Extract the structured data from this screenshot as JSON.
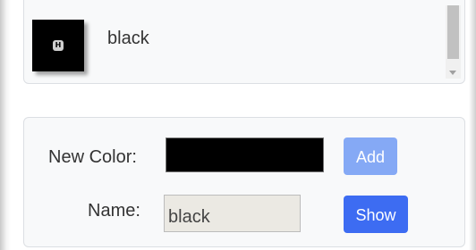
{
  "color_list": {
    "items": [
      {
        "label": "black",
        "swatch_color": "#000000",
        "icon": "app-icon"
      }
    ]
  },
  "form": {
    "new_color_label": "New Color:",
    "new_color_value": "#000000",
    "name_label": "Name:",
    "name_value": "black",
    "add_label": "Add",
    "show_label": "Show"
  },
  "colors": {
    "add_button": "#85a9f5",
    "show_button": "#3d6cf2"
  }
}
